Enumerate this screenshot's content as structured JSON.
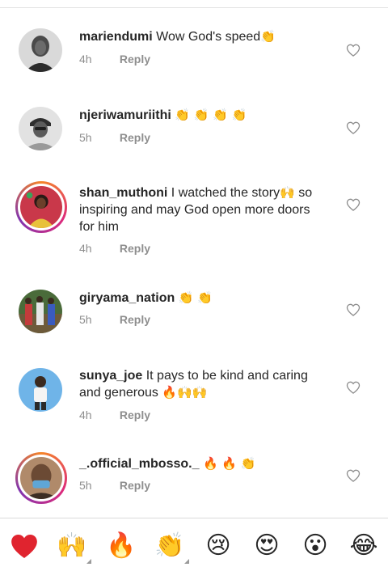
{
  "comments": [
    {
      "username": "mariendumi",
      "text": "Wow God's speed",
      "emoji": "👏",
      "time": "4h",
      "reply": "Reply"
    },
    {
      "username": "njeriwamuriithi",
      "text": "",
      "emoji": "👏 👏 👏 👏",
      "time": "5h",
      "reply": "Reply"
    },
    {
      "username": "shan_muthoni",
      "text": "I watched the story",
      "emoji": "🙌",
      "text2": "so inspiring and may God open more doors for him",
      "time": "4h",
      "reply": "Reply"
    },
    {
      "username": "giryama_nation",
      "text": "",
      "emoji": "👏 👏",
      "time": "5h",
      "reply": "Reply"
    },
    {
      "username": "sunya_joe",
      "text": "It pays to be kind and caring and generous",
      "emoji": "🔥🙌🙌",
      "time": "4h",
      "reply": "Reply"
    },
    {
      "username": "_.official_mbosso._",
      "text": "",
      "emoji": "🔥 🔥 👏",
      "time": "5h",
      "reply": "Reply"
    }
  ],
  "reactions": [
    "❤️",
    "🙌",
    "🔥",
    "👏",
    "😢",
    "😍",
    "😮",
    "😂"
  ],
  "colors": {
    "story_ring_start": "#f58529",
    "story_ring_end": "#8134af",
    "meta_gray": "#8e8e8e",
    "heart_red": "#e0242f"
  }
}
